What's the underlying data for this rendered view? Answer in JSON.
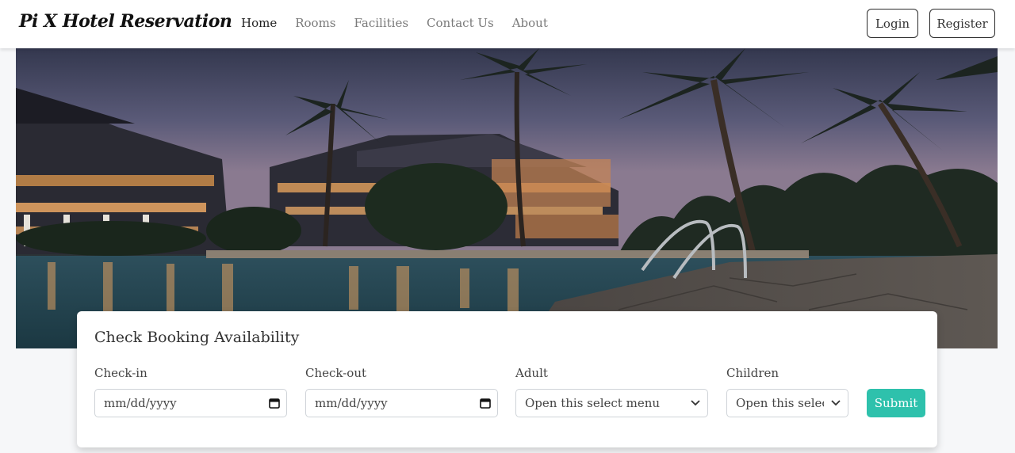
{
  "brand": "Pi X Hotel Reservation",
  "nav": {
    "links": [
      "Home",
      "Rooms",
      "Facilities",
      "Contact Us",
      "About"
    ],
    "login_label": "Login",
    "register_label": "Register"
  },
  "booking": {
    "title": "Check Booking Availability",
    "checkin_label": "Check-in",
    "checkin_placeholder": "mm/dd/yyyy",
    "checkout_label": "Check-out",
    "checkout_placeholder": "mm/dd/yyyy",
    "adult_label": "Adult",
    "adult_value": "Open this select menu",
    "children_label": "Children",
    "children_value": "Open this select menu",
    "submit_label": "Submit"
  },
  "colors": {
    "accent": "#2ec1ac"
  }
}
